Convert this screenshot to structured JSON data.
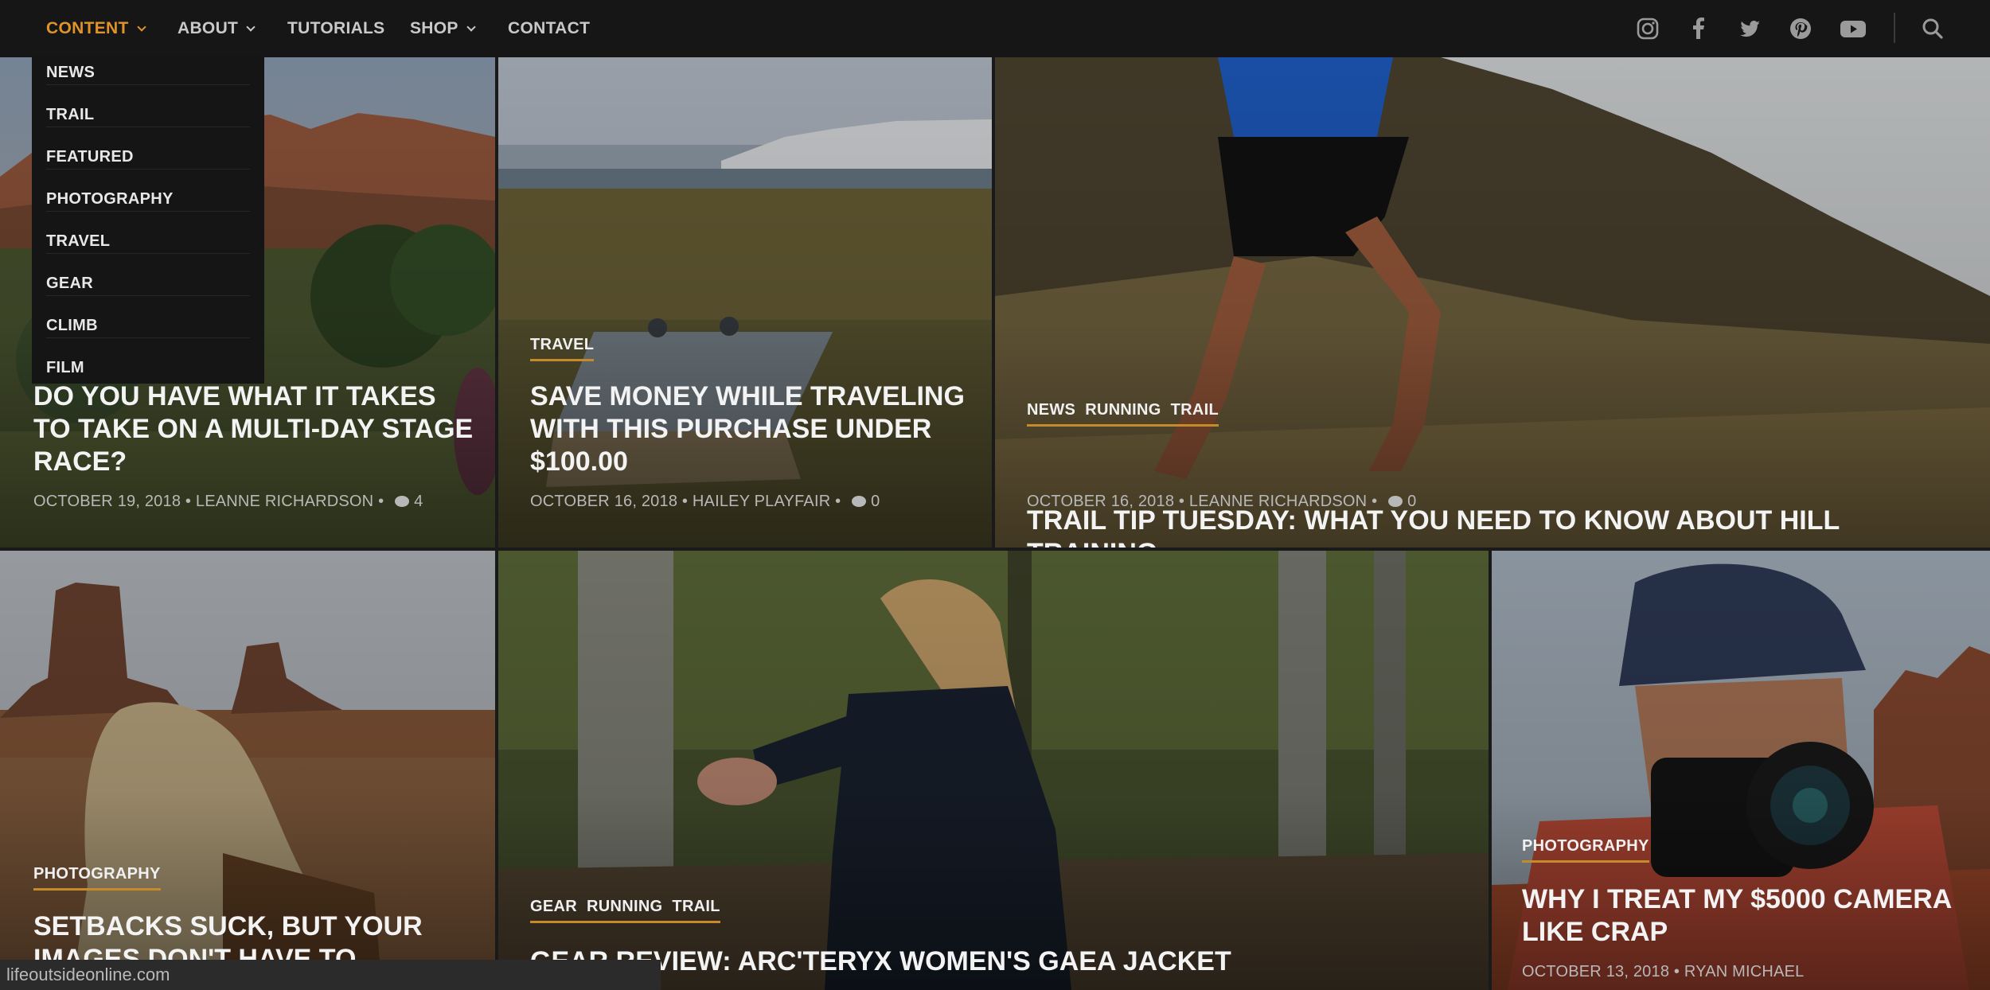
{
  "nav": {
    "items": [
      {
        "label": "CONTENT",
        "has_dropdown": true,
        "active": true
      },
      {
        "label": "ABOUT",
        "has_dropdown": true
      },
      {
        "label": "TUTORIALS"
      },
      {
        "label": "SHOP",
        "has_dropdown": true
      },
      {
        "label": "CONTACT"
      }
    ],
    "social_icons": [
      "instagram-icon",
      "facebook-icon",
      "twitter-icon",
      "pinterest-icon",
      "youtube-icon"
    ],
    "search_icon": "search-icon",
    "accent_color": "#e0932a"
  },
  "dropdown": {
    "items": [
      "NEWS",
      "TRAIL",
      "FEATURED",
      "PHOTOGRAPHY",
      "TRAVEL",
      "GEAR",
      "CLIMB",
      "FILM"
    ]
  },
  "posts": [
    {
      "categories": [],
      "title": "DO YOU HAVE WHAT IT TAKES TO TAKE ON A MULTI-DAY STAGE RACE?",
      "date": "OCTOBER 19, 2018",
      "author": "LEANNE RICHARDSON",
      "comments": "4"
    },
    {
      "categories": [
        "TRAVEL"
      ],
      "title": "SAVE MONEY WHILE TRAVELING WITH THIS PURCHASE UNDER $100.00",
      "date": "OCTOBER 16, 2018",
      "author": "HAILEY PLAYFAIR",
      "comments": "0"
    },
    {
      "categories": [
        "NEWS",
        "RUNNING",
        "TRAIL"
      ],
      "title": "TRAIL TIP TUESDAY: WHAT YOU NEED TO KNOW ABOUT HILL TRAINING",
      "date": "OCTOBER 16, 2018",
      "author": "LEANNE RICHARDSON",
      "comments": "0"
    },
    {
      "categories": [
        "PHOTOGRAPHY"
      ],
      "title": "SETBACKS SUCK, BUT YOUR IMAGES DON'T HAVE TO"
    },
    {
      "categories": [
        "GEAR",
        "RUNNING",
        "TRAIL"
      ],
      "title": "GEAR REVIEW: ARC'TERYX WOMEN'S GAEA JACKET"
    },
    {
      "categories": [
        "PHOTOGRAPHY"
      ],
      "title": "WHY I TREAT MY $5000 CAMERA LIKE CRAP",
      "date": "OCTOBER 13, 2018",
      "author": "RYAN MICHAEL"
    }
  ],
  "status_bar": {
    "url": "lifeoutsideonline.com"
  },
  "meta_separator": "•"
}
